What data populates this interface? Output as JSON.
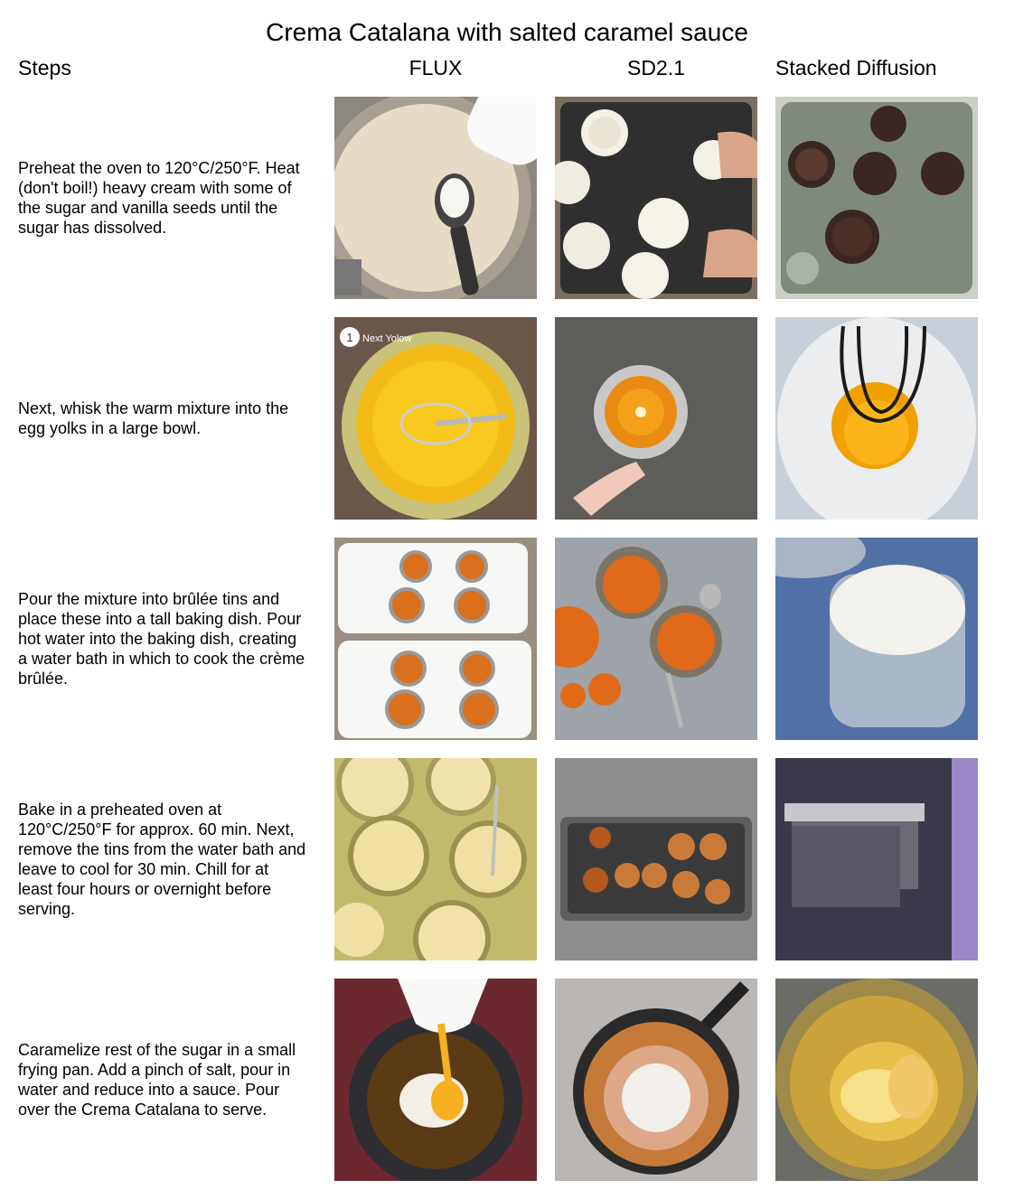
{
  "title": "Crema Catalana with salted caramel sauce",
  "headers": {
    "steps": "Steps",
    "col1": "FLUX",
    "col2": "SD2.1",
    "col3": "Stacked Diffusion"
  },
  "steps": [
    "Preheat the oven to 120°C/250°F. Heat (don't boil!) heavy cream with some of the sugar and vanilla seeds until the sugar has dissolved.",
    "Next, whisk the warm mixture into the egg yolks in a large bowl.",
    "Pour the mixture into brûlée tins and place these into a tall baking dish. Pour hot water into the baking dish, creating a water bath in which to cook the crème brûlée.",
    "Bake in a preheated oven at 120°C/250°F for approx. 60 min. Next, remove the tins from the water bath and leave to cool for 30 min. Chill for at least four hours or overnight before serving.",
    "Caramelize rest of the sugar in a small frying pan. Add a pinch of salt, pour in water and reduce into a sauce. Pour over the Crema Catalana to serve."
  ],
  "image_text": {
    "flux_step2_badge_number": "1",
    "flux_step2_badge_label": "Next Yolow"
  },
  "colors": {
    "cream": "#e8dcc4",
    "yolk": "#f5b21a",
    "caramel": "#d9701e",
    "dark": "#2a2a2a"
  }
}
